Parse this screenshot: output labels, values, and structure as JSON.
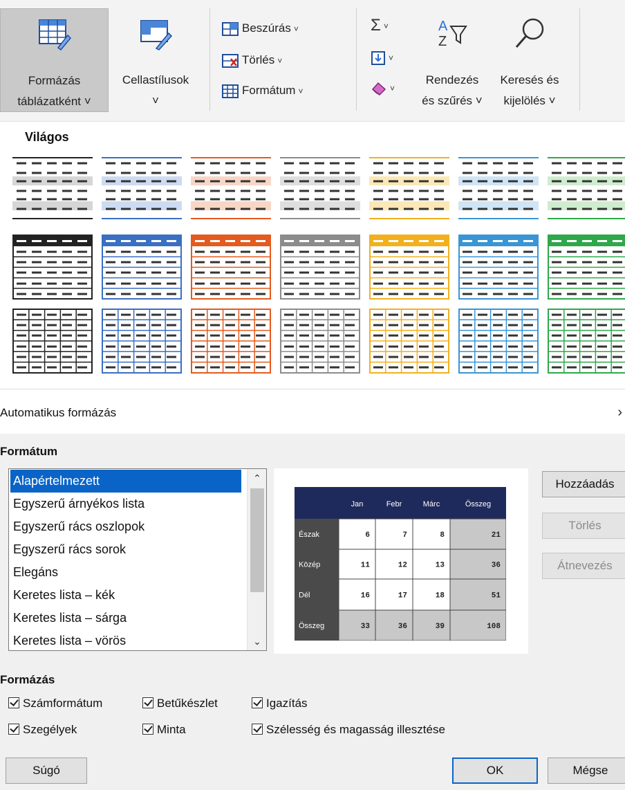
{
  "ribbon": {
    "format_as_table": {
      "line1": "Formázás",
      "line2": "táblázatként ˅"
    },
    "cell_styles": {
      "line1": "Cellastílusok",
      "line2": "˅"
    },
    "insert": "Beszúrás",
    "delete": "Törlés",
    "format": "Formátum",
    "sum_icon": "sigma-icon",
    "fill_icon": "fill-down-icon",
    "clear_icon": "eraser-icon",
    "sort": {
      "line1": "Rendezés",
      "line2": "és szűrés ˅"
    },
    "find": {
      "line1": "Keresés és",
      "line2": "kijelölés ˅"
    },
    "caret": "˅"
  },
  "gallery": {
    "title": "Világos",
    "colors": [
      "#222222",
      "#3a6fc2",
      "#e35b1e",
      "#8c8c8c",
      "#f2b01e",
      "#3a95d4",
      "#2ea84a"
    ],
    "tints": [
      "#d6d6d6",
      "#cddbf2",
      "#f8d6c6",
      "#dedede",
      "#fbe8b6",
      "#cfe4f4",
      "#cfeccf"
    ],
    "rows": 3
  },
  "dialog": {
    "title": "Automatikus formázás",
    "close": "›",
    "format_section": "Formátum",
    "formats": [
      "Alapértelmezett",
      "Egyszerű árnyékos lista",
      "Egyszerű rács oszlopok",
      "Egyszerű rács sorok",
      "Elegáns",
      "Keretes lista – kék",
      "Keretes lista – sárga",
      "Keretes lista – vörös"
    ],
    "selected_index": 0,
    "scroll_up": "⌃",
    "scroll_down": "⌄",
    "buttons": {
      "add": "Hozzáadás",
      "delete": "Törlés",
      "rename": "Átnevezés",
      "help": "Súgó",
      "ok": "OK",
      "cancel": "Mégse"
    },
    "formatting_section": "Formázás",
    "options": [
      {
        "label": "Számformátum",
        "checked": true
      },
      {
        "label": "Betűkészlet",
        "checked": true
      },
      {
        "label": "Igazítás",
        "checked": true
      },
      {
        "label": "Szegélyek",
        "checked": true
      },
      {
        "label": "Minta",
        "checked": true
      },
      {
        "label": "Szélesség és magasság illesztése",
        "checked": true
      }
    ],
    "preview": {
      "headers": [
        "",
        "Jan",
        "Febr",
        "Márc",
        "Összeg"
      ],
      "rows": [
        {
          "label": "Észak",
          "values": [
            "6",
            "7",
            "8",
            "21"
          ]
        },
        {
          "label": "Közép",
          "values": [
            "11",
            "12",
            "13",
            "36"
          ]
        },
        {
          "label": "Dél",
          "values": [
            "16",
            "17",
            "18",
            "51"
          ]
        },
        {
          "label": "Összeg",
          "values": [
            "33",
            "36",
            "39",
            "108"
          ]
        }
      ]
    }
  }
}
